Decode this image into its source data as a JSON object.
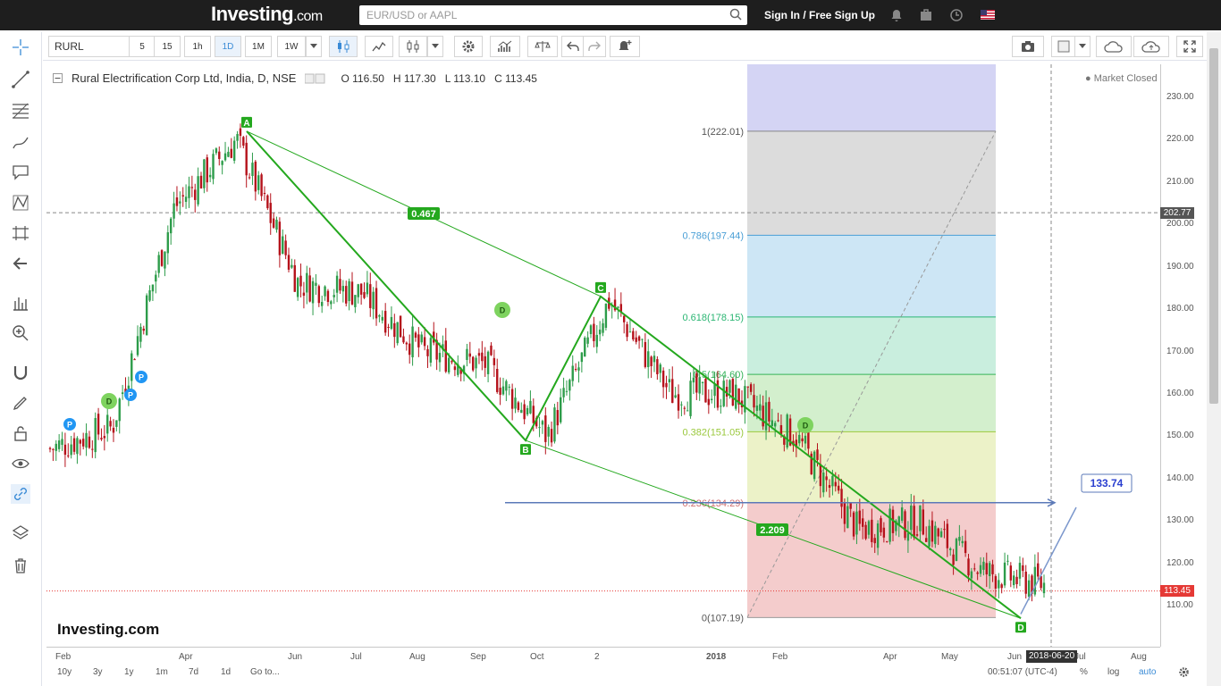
{
  "header": {
    "brand": "Investing",
    "brand_domain": ".com",
    "search_placeholder": "EUR/USD or AAPL",
    "signin_label": "Sign In / Free Sign Up"
  },
  "toolbar": {
    "symbol": "RURL",
    "intervals": [
      "5",
      "15",
      "1h",
      "1D",
      "1M",
      "1W"
    ],
    "active_interval": "1D"
  },
  "legend": {
    "title": "Rural Electrification Corp Ltd, India, D, NSE",
    "open": "O 116.50",
    "high": "H 117.30",
    "low": "L 113.10",
    "close": "C 113.45",
    "status": "Market Closed"
  },
  "watermark": "Investing.com",
  "price_axis": {
    "labels": [
      "230.00",
      "220.00",
      "210.00",
      "200.00",
      "190.00",
      "180.00",
      "170.00",
      "160.00",
      "150.00",
      "140.00",
      "130.00",
      "120.00",
      "110.00"
    ],
    "crosshair_price": "202.77",
    "last_price": "113.45"
  },
  "time_axis": {
    "labels": [
      "Feb",
      "Apr",
      "Jun",
      "Jul",
      "Aug",
      "Sep",
      "Oct",
      "2",
      "2018",
      "Feb",
      "Apr",
      "May",
      "Jun",
      "Jul",
      "Aug"
    ],
    "crosshair_date": "2018-06-20"
  },
  "bottom_bar": {
    "ranges": [
      "10y",
      "3y",
      "1y",
      "1m",
      "7d",
      "1d"
    ],
    "goto": "Go to...",
    "clock": "00:51:07 (UTC-4)",
    "percent": "%",
    "log": "log",
    "auto": "auto"
  },
  "drawings": {
    "pattern_labels": [
      "A",
      "B",
      "C",
      "D"
    ],
    "ratio_labels": [
      "0.467",
      "2.209"
    ],
    "target_label": "133.74",
    "fib_levels": [
      "1(222.01)",
      "0.786(197.44)",
      "0.618(178.15)",
      "0.5(164.60)",
      "0.382(151.05)",
      "0.236(134.29)",
      "0(107.19)"
    ],
    "markers": [
      "P",
      "P",
      "P",
      "D",
      "D",
      "D"
    ]
  },
  "colors": {
    "up": "#2d9c4a",
    "down": "#b5121b",
    "pattern": "#24a81e",
    "last_price": "#e53935"
  },
  "chart_data": {
    "type": "candlestick",
    "title": "Rural Electrification Corp Ltd, India, D, NSE",
    "ylim": [
      103,
      234
    ],
    "last": {
      "open": 116.5,
      "high": 117.3,
      "low": 113.1,
      "close": 113.45
    },
    "approx_close_path": [
      {
        "x": "Feb",
        "y": 147
      },
      {
        "x": "Mar",
        "y": 152
      },
      {
        "x": "Apr",
        "y": 204
      },
      {
        "x": "May",
        "y": 220
      },
      {
        "x": "Jun",
        "y": 186
      },
      {
        "x": "Jul",
        "y": 184
      },
      {
        "x": "Aug",
        "y": 170
      },
      {
        "x": "Sep",
        "y": 167
      },
      {
        "x": "Oct",
        "y": 150
      },
      {
        "x": "Nov",
        "y": 182
      },
      {
        "x": "Dec",
        "y": 160
      },
      {
        "x": "2018",
        "y": 160
      },
      {
        "x": "Feb",
        "y": 150
      },
      {
        "x": "Mar",
        "y": 128
      },
      {
        "x": "Apr",
        "y": 130
      },
      {
        "x": "May",
        "y": 118
      },
      {
        "x": "Jun",
        "y": 115
      }
    ],
    "pattern_points": [
      {
        "label": "A",
        "y": 222
      },
      {
        "label": "B",
        "y": 149
      },
      {
        "label": "C",
        "y": 183
      },
      {
        "label": "D",
        "y": 107
      }
    ],
    "target": 133.74
  }
}
